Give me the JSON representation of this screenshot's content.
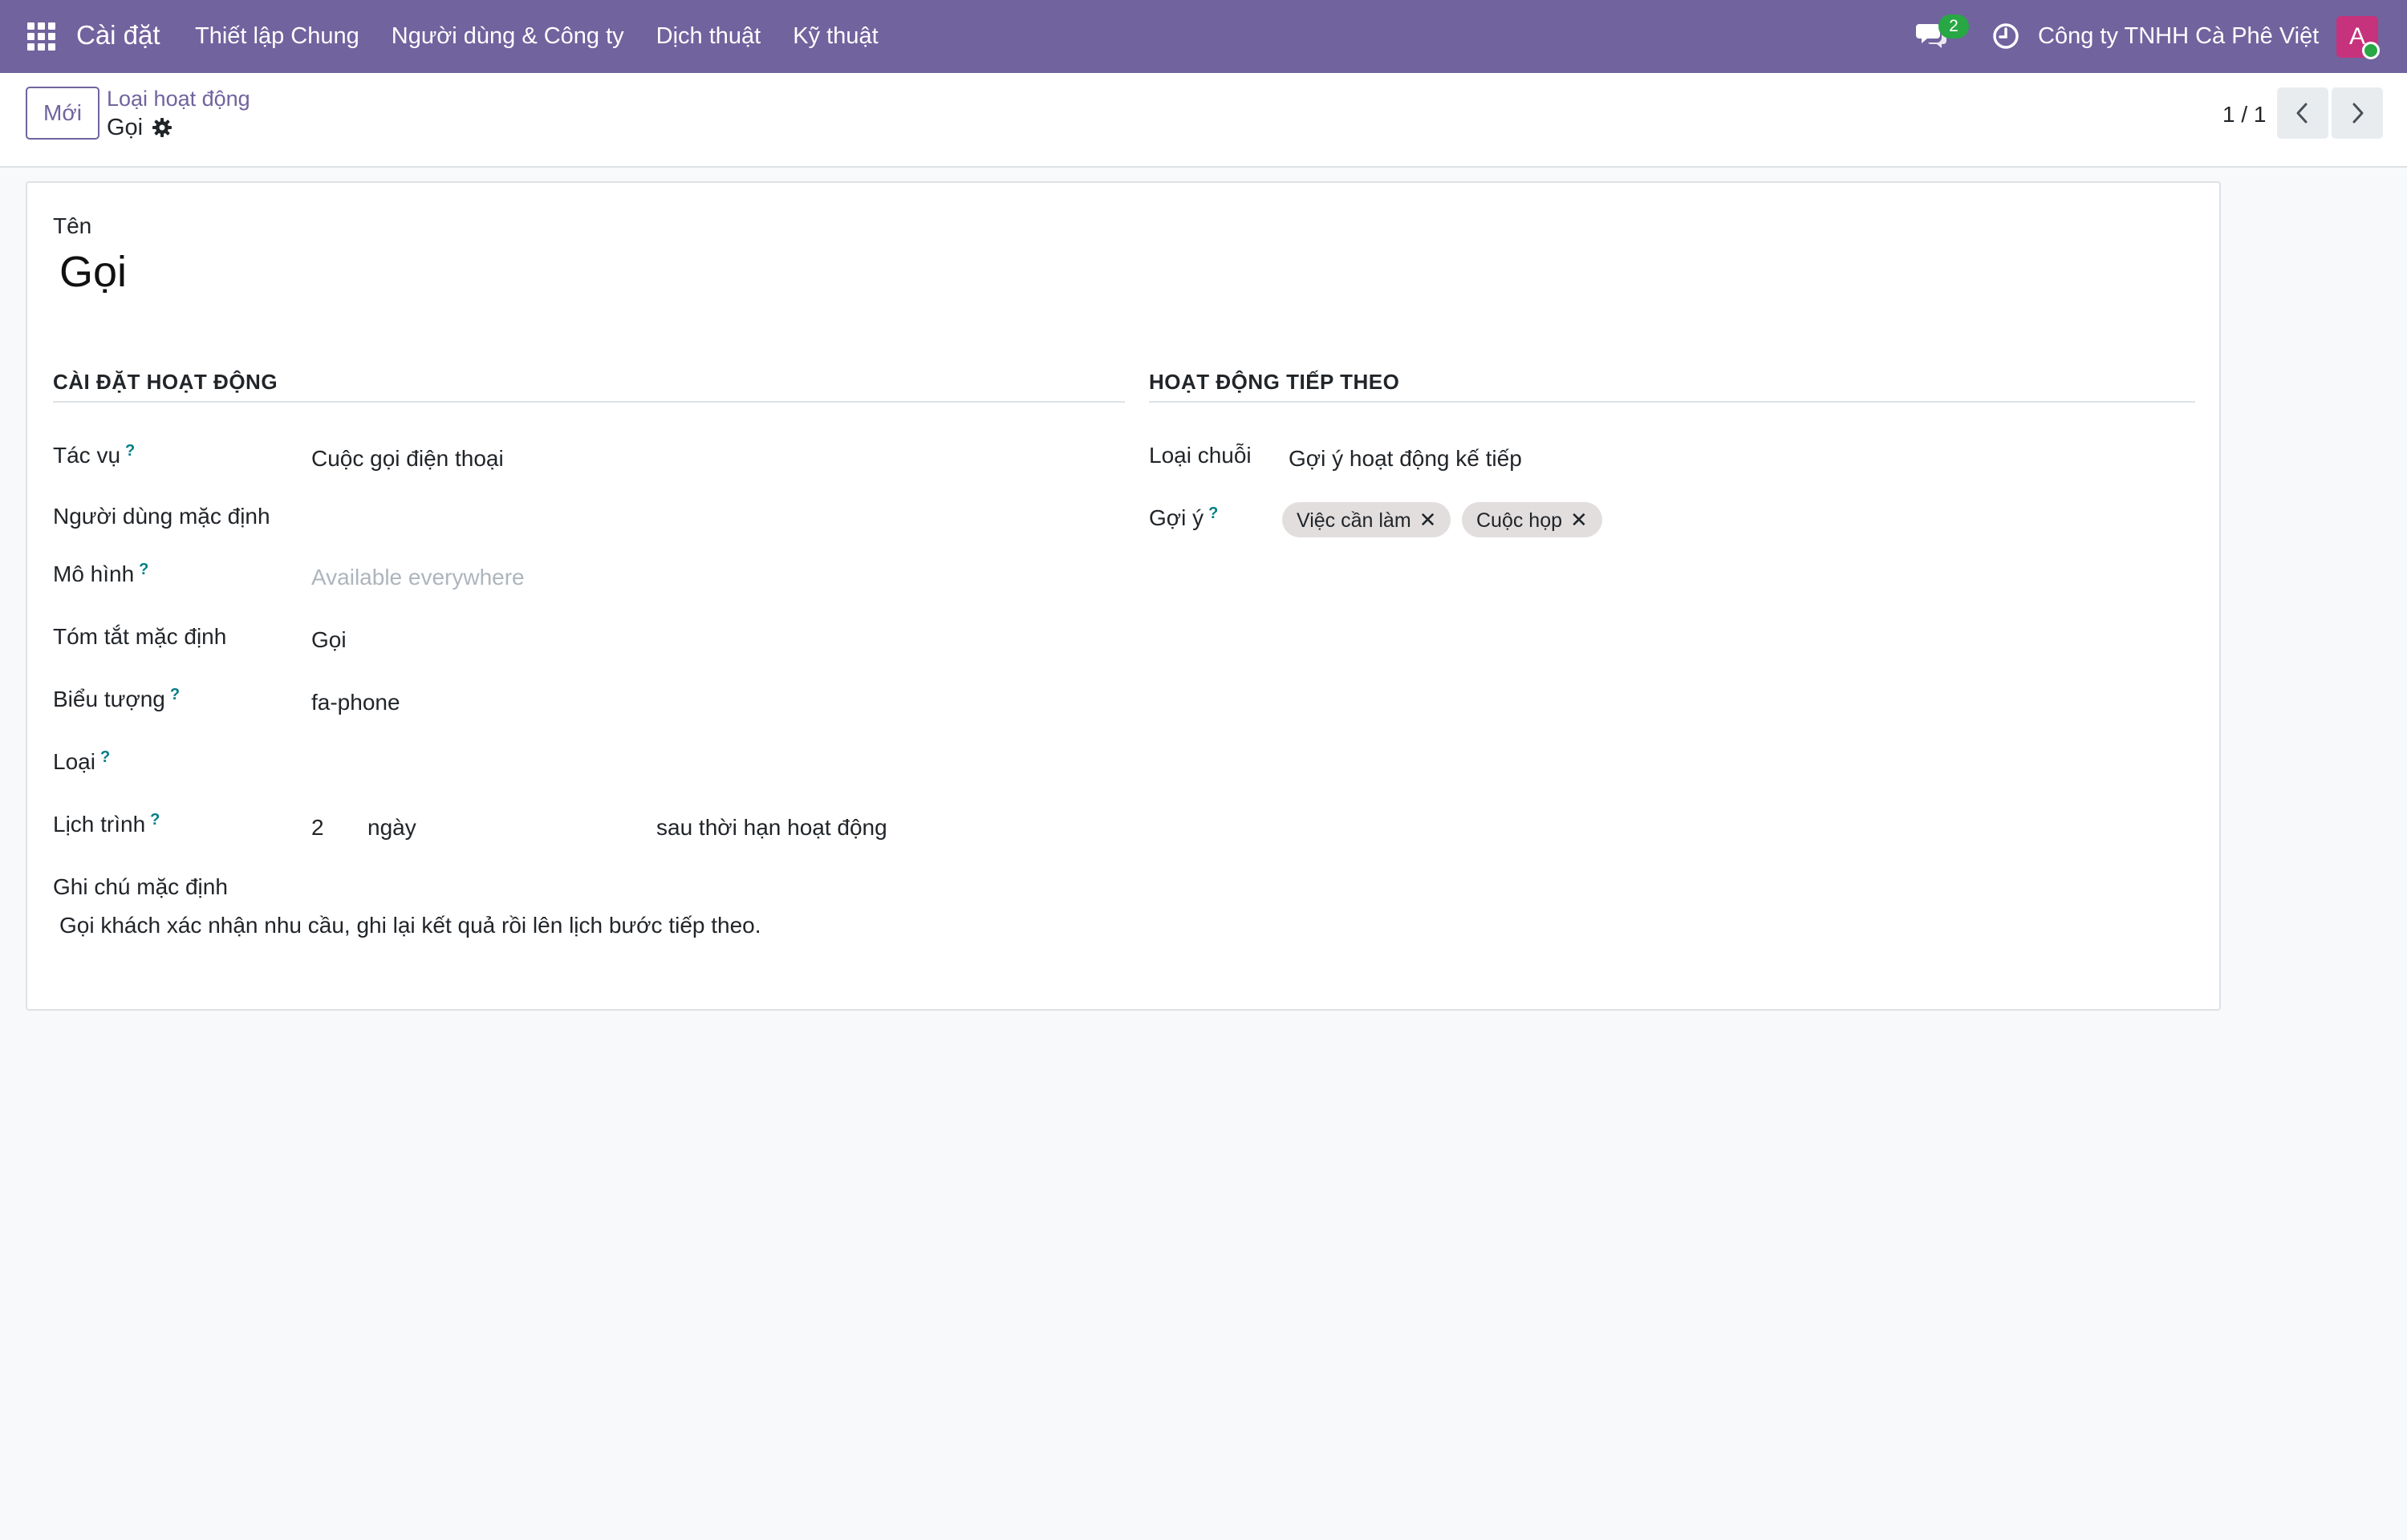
{
  "navbar": {
    "app_name": "Cài đặt",
    "menu": [
      "Thiết lập Chung",
      "Người dùng & Công ty",
      "Dịch thuật",
      "Kỹ thuật"
    ],
    "chat_count": "2",
    "company": "Công ty TNHH Cà Phê Việt",
    "avatar_initial": "A",
    "avatar_color": "#c7327c",
    "brand_color": "#71639e"
  },
  "control_panel": {
    "new_button": "Mới",
    "breadcrumb_parent": "Loại hoạt động",
    "breadcrumb_current": "Gọi",
    "pager": "1 / 1"
  },
  "form": {
    "name_label": "Tên",
    "name_value": "Gọi",
    "left_group": {
      "title": "CÀI ĐẶT HOẠT ĐỘNG",
      "fields": {
        "task_label": "Tác vụ",
        "task_value": "Cuộc gọi điện thoại",
        "default_user_label": "Người dùng mặc định",
        "default_user_value": "",
        "model_label": "Mô hình",
        "model_placeholder": "Available everywhere",
        "default_summary_label": "Tóm tắt mặc định",
        "default_summary_value": "Gọi",
        "icon_label": "Biểu tượng",
        "icon_value": "fa-phone",
        "type_label": "Loại",
        "type_value": "",
        "schedule_label": "Lịch trình",
        "schedule_number": "2",
        "schedule_unit": "ngày",
        "schedule_from": "sau thời hạn hoạt động"
      }
    },
    "right_group": {
      "title": "HOẠT ĐỘNG TIẾP THEO",
      "chain_type_label": "Loại chuỗi",
      "chain_type_value": "Gợi ý hoạt động kế tiếp",
      "suggest_label": "Gợi ý",
      "suggest_tags": [
        "Việc cần làm",
        "Cuộc họp"
      ]
    },
    "default_note_label": "Ghi chú mặc định",
    "default_note_value": "Gọi khách xác nhận nhu cầu, ghi lại kết quả rồi lên lịch bước tiếp theo.",
    "help_mark": "?"
  }
}
